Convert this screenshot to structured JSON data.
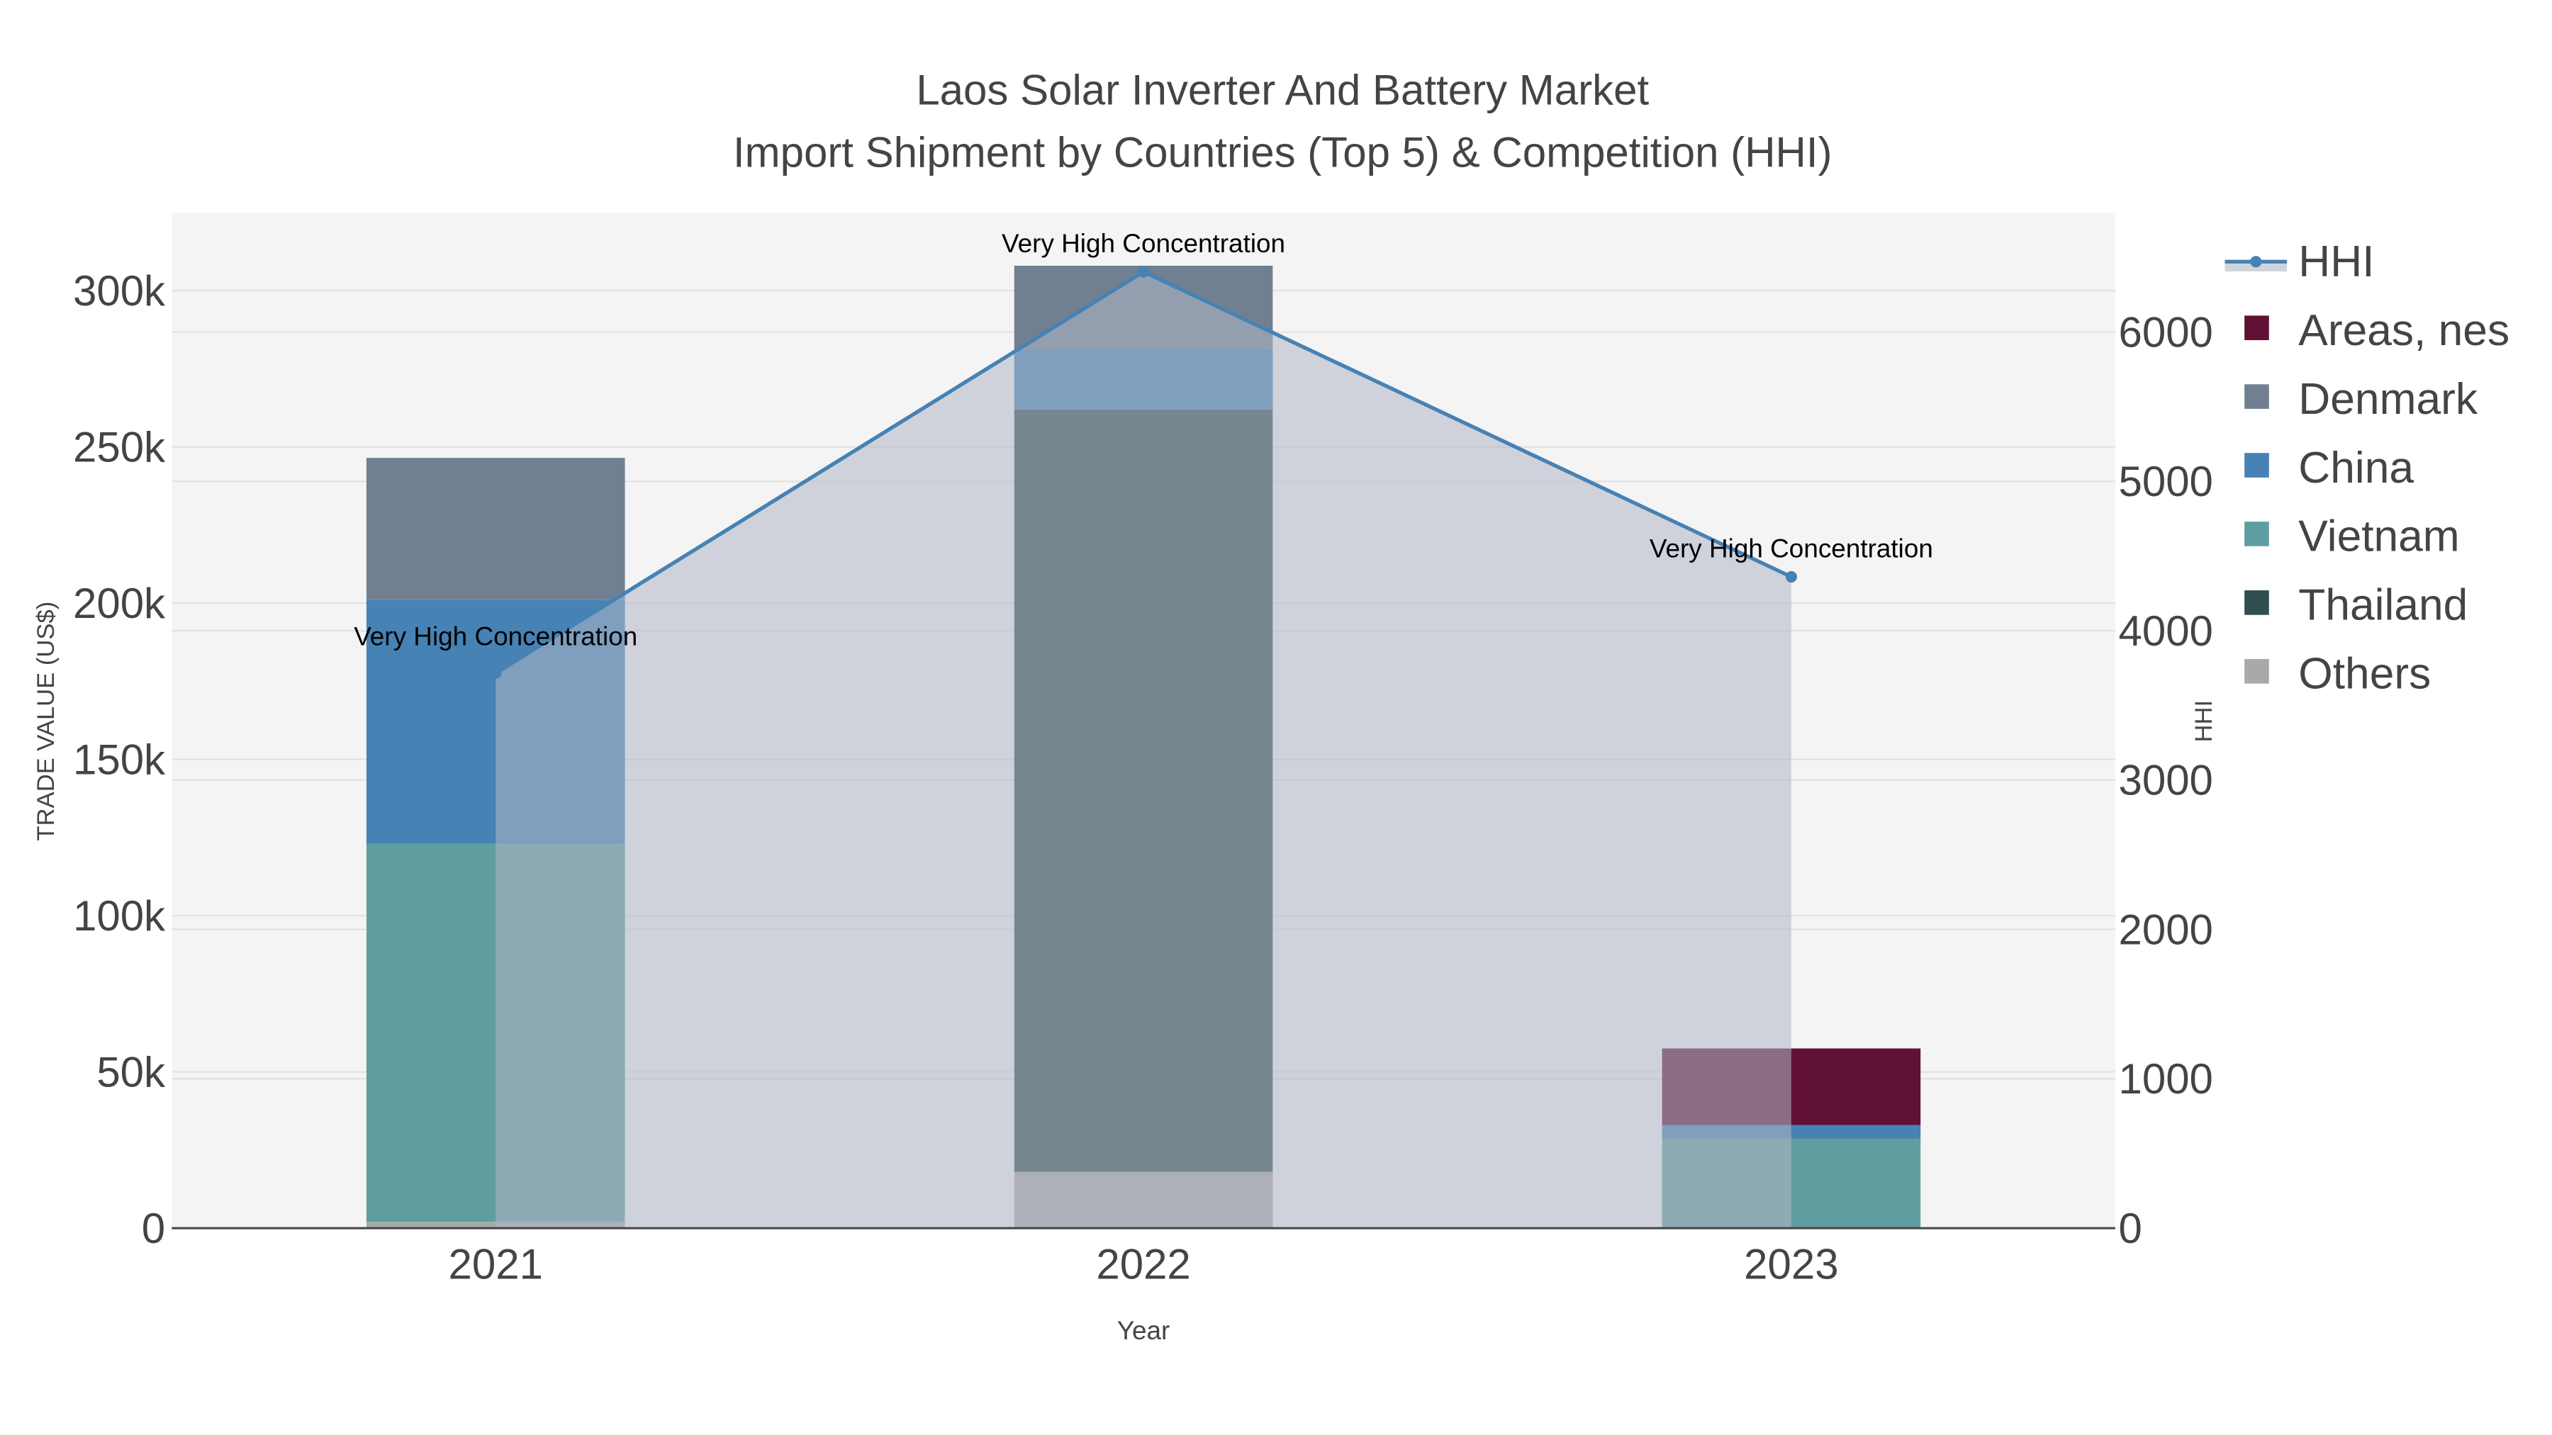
{
  "chart_data": {
    "type": "bar",
    "title": "Laos Solar Inverter And Battery Market",
    "subtitle": "Import Shipment by Countries (Top 5) & Competition (HHI)",
    "xlabel": "Year",
    "ylabel": "TRADE VALUE (US$)",
    "y2label": "HHI",
    "categories": [
      "2021",
      "2022",
      "2023"
    ],
    "ylim": [
      0,
      325000
    ],
    "y2lim": [
      0,
      6800
    ],
    "yticks": [
      0,
      50000,
      100000,
      150000,
      200000,
      250000,
      300000
    ],
    "ytick_labels": [
      "0",
      "50k",
      "100k",
      "150k",
      "200k",
      "250k",
      "300k"
    ],
    "y2ticks": [
      0,
      1000,
      2000,
      3000,
      4000,
      5000,
      6000
    ],
    "y2tick_labels": [
      "0",
      "1000",
      "2000",
      "3000",
      "4000",
      "5000",
      "6000"
    ],
    "stacked": true,
    "series": [
      {
        "name": "Others",
        "color": "#a9a9a9",
        "values": [
          2000,
          18000,
          0
        ]
      },
      {
        "name": "Thailand",
        "color": "#2f4f4f",
        "values": [
          0,
          244000,
          0
        ]
      },
      {
        "name": "Vietnam",
        "color": "#5f9ea0",
        "values": [
          121000,
          0,
          28700
        ]
      },
      {
        "name": "China",
        "color": "#4682b4",
        "values": [
          78000,
          19000,
          4300
        ]
      },
      {
        "name": "Denmark",
        "color": "#708090",
        "values": [
          45500,
          27000,
          0
        ]
      },
      {
        "name": "Areas, nes",
        "color": "#611134",
        "values": [
          0,
          0,
          24500
        ]
      }
    ],
    "line": {
      "name": "HHI",
      "color": "#4682b4",
      "values": [
        3716,
        6404,
        4361
      ],
      "annotations": [
        "Very High Concentration",
        "Very High Concentration",
        "Very High Concentration"
      ]
    },
    "legend": [
      "HHI",
      "Areas, nes",
      "Denmark",
      "China",
      "Vietnam",
      "Thailand",
      "Others"
    ],
    "legend_position": "right",
    "grid": true
  }
}
